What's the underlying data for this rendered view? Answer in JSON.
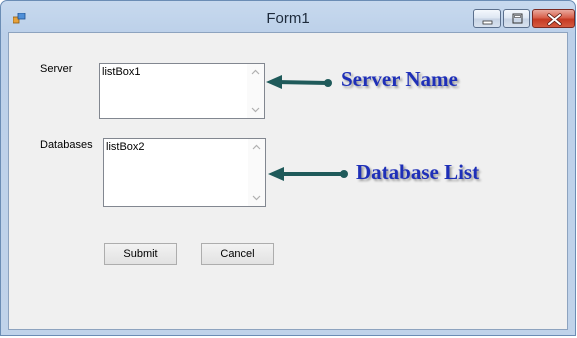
{
  "window": {
    "title": "Form1"
  },
  "form": {
    "server_label": "Server",
    "databases_label": "Databases",
    "server_list": {
      "items": [
        "listBox1"
      ]
    },
    "database_list": {
      "items": [
        "listBox2"
      ]
    },
    "submit_label": "Submit",
    "cancel_label": "Cancel"
  },
  "annotations": {
    "server_name": "Server Name",
    "database_list": "Database List",
    "color": "#1e2fb8",
    "arrow_color": "#1f5a5a"
  }
}
